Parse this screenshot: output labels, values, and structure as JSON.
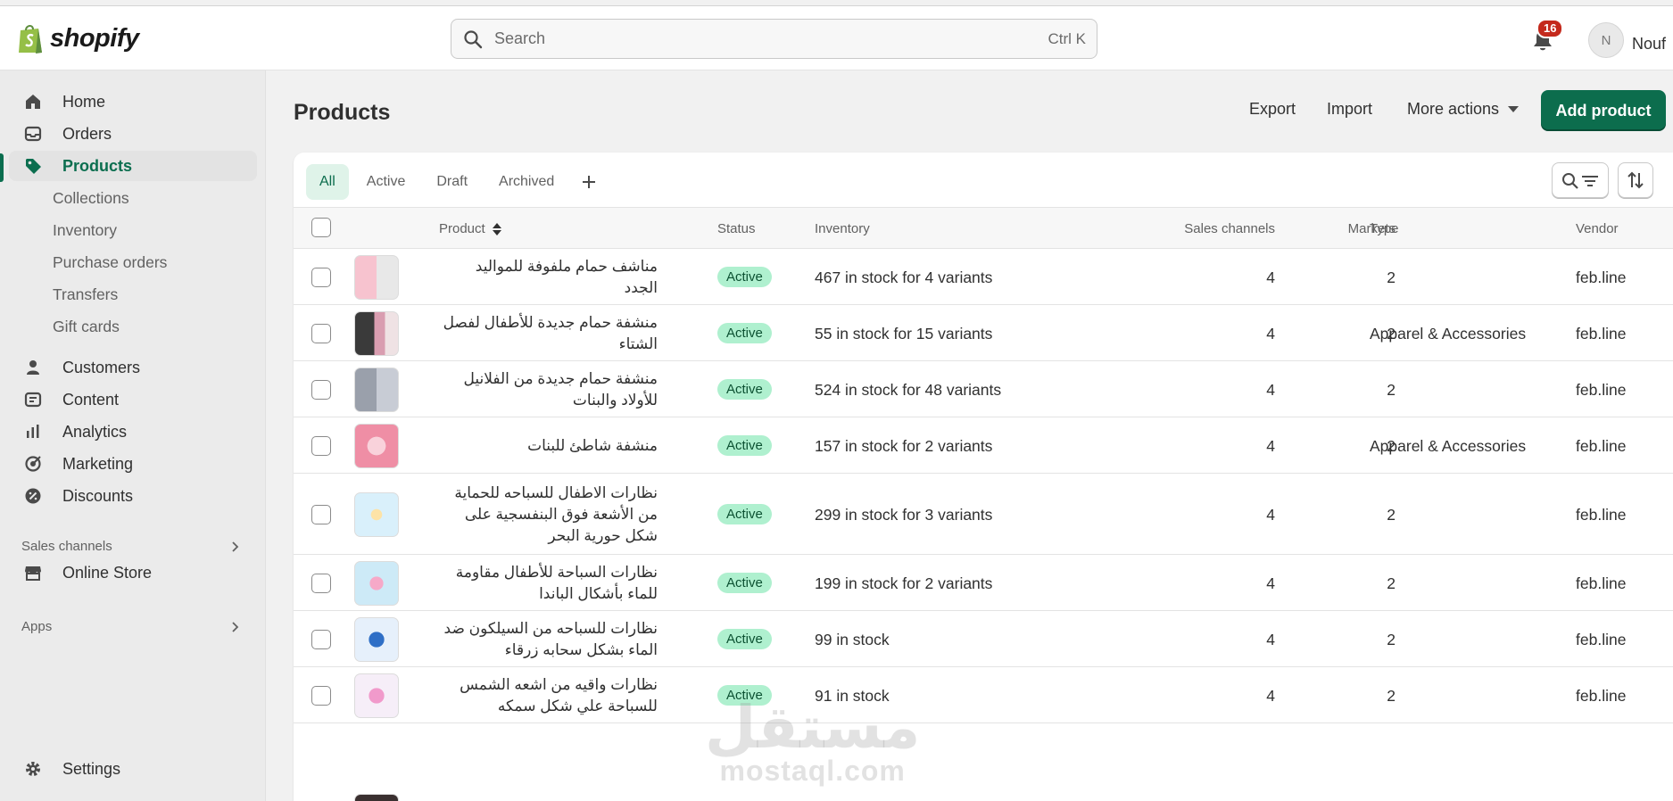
{
  "app": {
    "logo_text": "shopify"
  },
  "search": {
    "placeholder": "Search",
    "shortcut": "Ctrl K"
  },
  "notifications": {
    "count": "16"
  },
  "user": {
    "initial": "N",
    "name": "Nouf"
  },
  "sidebar": {
    "items": [
      {
        "label": "Home",
        "icon": "home-icon"
      },
      {
        "label": "Orders",
        "icon": "inbox-icon"
      },
      {
        "label": "Products",
        "icon": "tag-icon"
      },
      {
        "label": "Collections"
      },
      {
        "label": "Inventory"
      },
      {
        "label": "Purchase orders"
      },
      {
        "label": "Transfers"
      },
      {
        "label": "Gift cards"
      },
      {
        "label": "Customers",
        "icon": "person-icon"
      },
      {
        "label": "Content",
        "icon": "content-icon"
      },
      {
        "label": "Analytics",
        "icon": "bar-chart-icon"
      },
      {
        "label": "Marketing",
        "icon": "target-icon"
      },
      {
        "label": "Discounts",
        "icon": "discount-icon"
      }
    ],
    "sales_channels_label": "Sales channels",
    "online_store_label": "Online Store",
    "apps_label": "Apps",
    "settings_label": "Settings"
  },
  "page": {
    "title": "Products",
    "export_label": "Export",
    "import_label": "Import",
    "more_actions_label": "More actions",
    "add_product_label": "Add product"
  },
  "tabs": [
    "All",
    "Active",
    "Draft",
    "Archived"
  ],
  "columns": {
    "product": "Product",
    "status": "Status",
    "inventory": "Inventory",
    "sales_channels": "Sales channels",
    "markets": "Markets",
    "type": "Type",
    "vendor": "Vendor"
  },
  "rows": [
    {
      "name": "مناشف حمام ملفوفة للمواليد الجدد",
      "status": "Active",
      "inventory": "467 in stock for 4 variants",
      "sales_channels": "4",
      "markets": "2",
      "type": "",
      "vendor": "feb.line"
    },
    {
      "name": "منشفة حمام جديدة للأطفال لفصل الشتاء",
      "status": "Active",
      "inventory": "55 in stock for 15 variants",
      "sales_channels": "4",
      "markets": "2",
      "type": "Apparel & Accessories",
      "vendor": "feb.line"
    },
    {
      "name": "منشفة حمام جديدة من الفلانيل للأولاد والبنات",
      "status": "Active",
      "inventory": "524 in stock for 48 variants",
      "sales_channels": "4",
      "markets": "2",
      "type": "",
      "vendor": "feb.line"
    },
    {
      "name": "منشفة شاطئ للبنات",
      "status": "Active",
      "inventory": "157 in stock for 2 variants",
      "sales_channels": "4",
      "markets": "2",
      "type": "Apparel & Accessories",
      "vendor": "feb.line"
    },
    {
      "name": "نظارات الاطفال للسباحه للحماية من الأشعة فوق البنفسجية على شكل حورية البحر",
      "status": "Active",
      "inventory": "299 in stock for 3 variants",
      "sales_channels": "4",
      "markets": "2",
      "type": "",
      "vendor": "feb.line"
    },
    {
      "name": "نظارات السباحة للأطفال مقاومة للماء بأشكال الباندا",
      "status": "Active",
      "inventory": "199 in stock for 2 variants",
      "sales_channels": "4",
      "markets": "2",
      "type": "",
      "vendor": "feb.line"
    },
    {
      "name": "نظارات للسباحه من السيلكون ضد الماء بشكل سحابه زرقاء",
      "status": "Active",
      "inventory": "99 in stock",
      "sales_channels": "4",
      "markets": "2",
      "type": "",
      "vendor": "feb.line"
    },
    {
      "name": "نظارات واقيه من اشعه الشمس للسباحة علي شكل سمكه",
      "status": "Active",
      "inventory": "91 in stock",
      "sales_channels": "4",
      "markets": "2",
      "type": "",
      "vendor": "feb.line"
    }
  ],
  "watermark": {
    "arabic": "مستقل",
    "latin": "mostaql.com"
  },
  "colors": {
    "brand_green": "#0c6d4d",
    "status_active_bg": "#aff0cf",
    "badge_red": "#c4291c"
  }
}
